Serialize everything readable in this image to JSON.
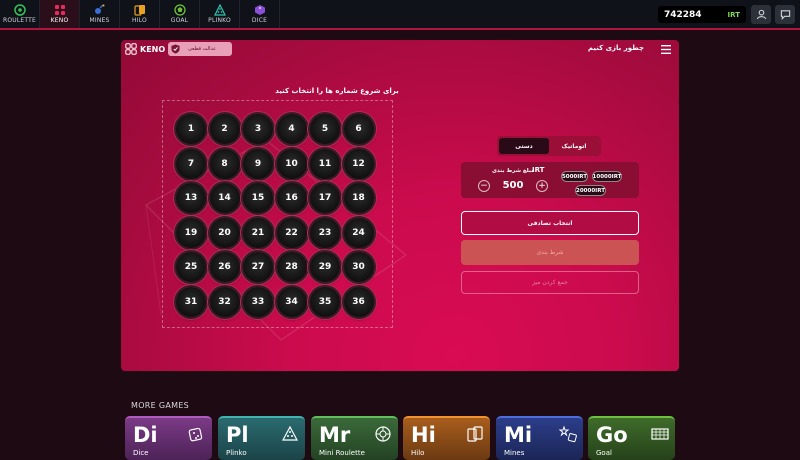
{
  "nav": {
    "items": [
      {
        "label": "ROULETTE",
        "icon": "roulette-icon",
        "active": false
      },
      {
        "label": "KENO",
        "icon": "keno-icon",
        "active": true
      },
      {
        "label": "MINES",
        "icon": "mines-icon",
        "active": false
      },
      {
        "label": "HILO",
        "icon": "hilo-icon",
        "active": false
      },
      {
        "label": "GOAL",
        "icon": "goal-icon",
        "active": false
      },
      {
        "label": "PLINKO",
        "icon": "plinko-icon",
        "active": false
      },
      {
        "label": "DICE",
        "icon": "dice-icon",
        "active": false
      }
    ]
  },
  "balance": {
    "amount": "742284",
    "currency": "IRT"
  },
  "game": {
    "logo_text": "KENO",
    "fairness_label": "عدالت قطعی",
    "how_to_play": "چطور بازی کنیم",
    "instruction": "برای شروع شماره ها را انتخاب کنید",
    "numbers": [
      "1",
      "2",
      "3",
      "4",
      "5",
      "6",
      "7",
      "8",
      "9",
      "10",
      "11",
      "12",
      "13",
      "14",
      "15",
      "16",
      "17",
      "18",
      "19",
      "20",
      "21",
      "22",
      "23",
      "24",
      "25",
      "26",
      "27",
      "28",
      "29",
      "30",
      "31",
      "32",
      "33",
      "34",
      "35",
      "36"
    ]
  },
  "controls": {
    "mode_manual": "دستی",
    "mode_auto": "اتوماتیک",
    "bet_label": "مبلغ شرط بندی",
    "bet_currency": "IRT",
    "bet_value": "500",
    "minus": "−",
    "plus": "+",
    "chips": [
      "5000IRT",
      "10000IRT",
      "20000IRT"
    ],
    "random_pick": "انتخاب تصادفی",
    "place_bet": "شرط بندی",
    "clear_table": "جمع کردن میز"
  },
  "more_games": {
    "title": "MORE GAMES",
    "cards": [
      {
        "abbr": "Di",
        "name": "Dice",
        "icon": "dice-icon"
      },
      {
        "abbr": "Pl",
        "name": "Plinko",
        "icon": "plinko-icon"
      },
      {
        "abbr": "Mr",
        "name": "Mini Roulette",
        "icon": "roulette-wheel-icon"
      },
      {
        "abbr": "Hi",
        "name": "Hilo",
        "icon": "cards-icon"
      },
      {
        "abbr": "Mi",
        "name": "Mines",
        "icon": "mines-icon"
      },
      {
        "abbr": "Go",
        "name": "Goal",
        "icon": "goal-icon"
      }
    ]
  },
  "colors": {
    "accent": "#b0153f",
    "panel": "#cb0b4d",
    "currency": "#7ed957"
  }
}
